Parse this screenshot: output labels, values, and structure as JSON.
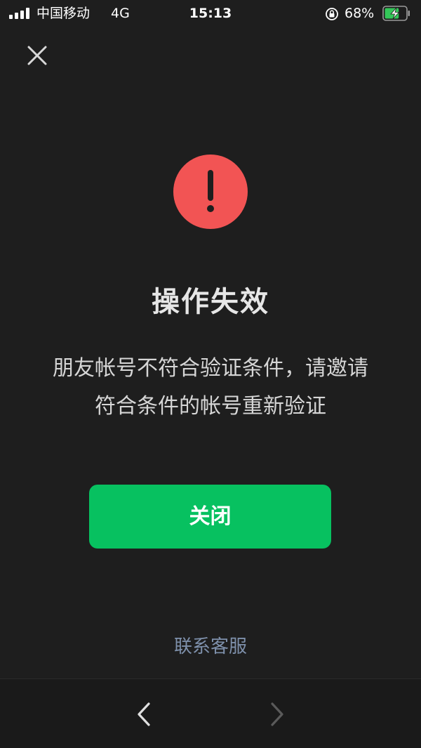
{
  "status_bar": {
    "carrier": "中国移动",
    "network": "4G",
    "time": "15:13",
    "battery_percent": "68%",
    "battery_level": 0.68,
    "charging": true
  },
  "dialog": {
    "title": "操作失效",
    "message": "朋友帐号不符合验证条件，请邀请符合条件的帐号重新验证",
    "primary_button": "关闭",
    "support_link": "联系客服"
  },
  "icons": {
    "close": "close-icon",
    "alert": "exclamation-circle-icon",
    "back": "chevron-left-icon",
    "forward": "chevron-right-icon",
    "orientation_lock": "orientation-lock-icon",
    "battery": "battery-charging-icon",
    "signal": "cellular-signal-icon"
  },
  "colors": {
    "background": "#1e1e1e",
    "alert_red": "#f25454",
    "primary_green": "#07c160",
    "link_blue_gray": "#7e90ab",
    "battery_green": "#34c759"
  }
}
